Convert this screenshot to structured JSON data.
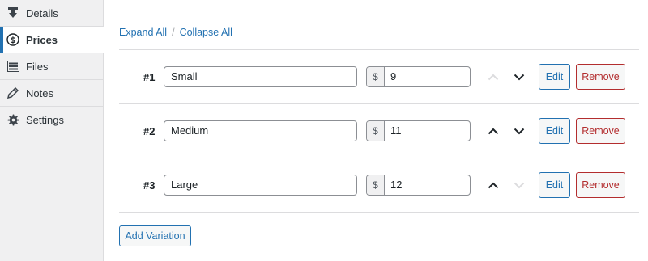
{
  "sidebar": {
    "items": [
      {
        "label": "Details",
        "icon": "download-icon",
        "active": false
      },
      {
        "label": "Prices",
        "icon": "dollar-circle-icon",
        "active": true
      },
      {
        "label": "Files",
        "icon": "list-icon",
        "active": false
      },
      {
        "label": "Notes",
        "icon": "pencil-icon",
        "active": false
      },
      {
        "label": "Settings",
        "icon": "gear-icon",
        "active": false
      }
    ]
  },
  "toolbar": {
    "expand_all": "Expand All",
    "separator": "/",
    "collapse_all": "Collapse All"
  },
  "variations": [
    {
      "number": "#1",
      "name": "Small",
      "currency": "$",
      "price": "9",
      "up_enabled": false,
      "down_enabled": true
    },
    {
      "number": "#2",
      "name": "Medium",
      "currency": "$",
      "price": "11",
      "up_enabled": true,
      "down_enabled": true
    },
    {
      "number": "#3",
      "name": "Large",
      "currency": "$",
      "price": "12",
      "up_enabled": true,
      "down_enabled": false
    }
  ],
  "buttons": {
    "edit": "Edit",
    "remove": "Remove",
    "add_variation": "Add Variation"
  },
  "colors": {
    "accent": "#2271b1",
    "danger": "#b32d2e",
    "disabled_arrow": "#dcdcde",
    "enabled_arrow": "#1d2327"
  }
}
